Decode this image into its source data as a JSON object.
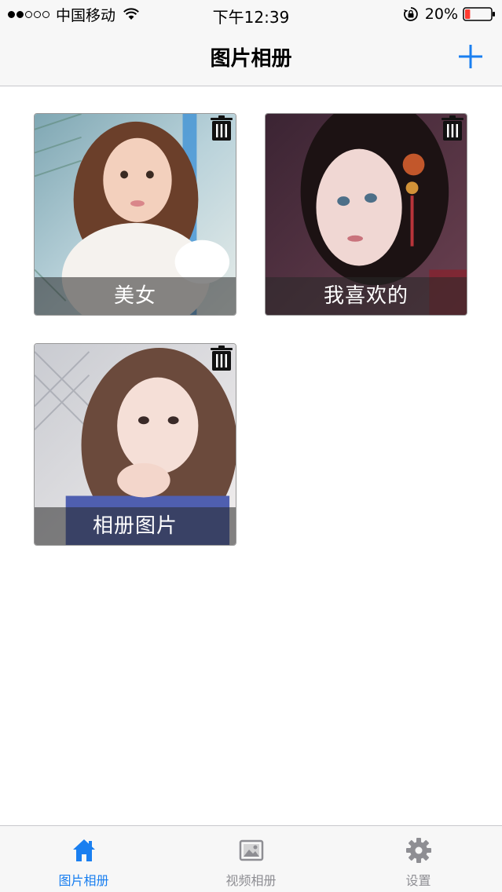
{
  "status_bar": {
    "carrier": "中国移动",
    "time": "下午12:39",
    "battery_percent": "20%",
    "battery_level": 0.2,
    "signal_strength": 2,
    "signal_max": 5
  },
  "nav": {
    "title": "图片相册",
    "add_icon": "plus-icon"
  },
  "albums": [
    {
      "title": "美女",
      "delete_icon": "trash-icon"
    },
    {
      "title": "我喜欢的",
      "delete_icon": "trash-icon"
    },
    {
      "title": "相册图片",
      "delete_icon": "trash-icon"
    }
  ],
  "tabs": [
    {
      "label": "图片相册",
      "icon": "home-icon",
      "active": true
    },
    {
      "label": "视频相册",
      "icon": "photo-icon",
      "active": false
    },
    {
      "label": "设置",
      "icon": "gear-icon",
      "active": false
    }
  ],
  "colors": {
    "accent": "#1a7ff0",
    "inactive_tab": "#8e8e93",
    "battery_low": "#ff3b30"
  }
}
